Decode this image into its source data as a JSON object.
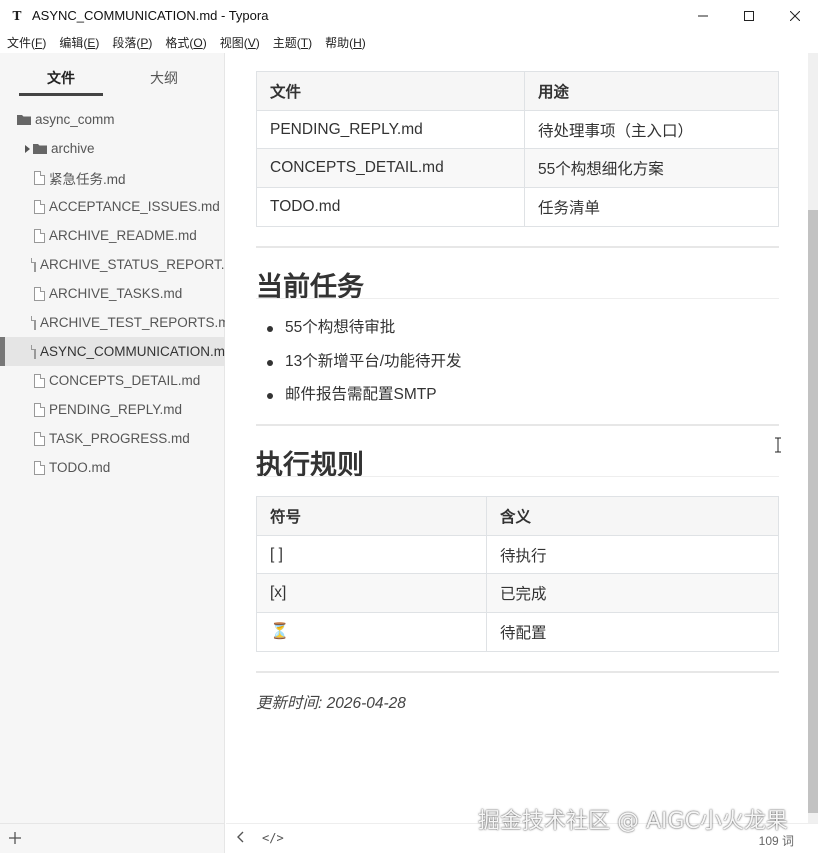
{
  "window": {
    "title": "ASYNC_COMMUNICATION.md - Typora",
    "app_icon_letter": "T"
  },
  "menu": [
    {
      "label": "文件(",
      "key": "F",
      "end": ")"
    },
    {
      "label": "编辑(",
      "key": "E",
      "end": ")"
    },
    {
      "label": "段落(",
      "key": "P",
      "end": ")"
    },
    {
      "label": "格式(",
      "key": "O",
      "end": ")"
    },
    {
      "label": "视图(",
      "key": "V",
      "end": ")"
    },
    {
      "label": "主题(",
      "key": "T",
      "end": ")"
    },
    {
      "label": "帮助(",
      "key": "H",
      "end": ")"
    }
  ],
  "sidebar": {
    "tab_files": "文件",
    "tab_outline": "大纲",
    "root_folder": "async_comm",
    "subfolder": "archive",
    "files": [
      "紧急任务.md",
      "ACCEPTANCE_ISSUES.md",
      "ARCHIVE_README.md",
      "ARCHIVE_STATUS_REPORT.md",
      "ARCHIVE_TASKS.md",
      "ARCHIVE_TEST_REPORTS.md",
      "ASYNC_COMMUNICATION.md",
      "CONCEPTS_DETAIL.md",
      "PENDING_REPLY.md",
      "TASK_PROGRESS.md",
      "TODO.md"
    ],
    "active_file": "ASYNC_COMMUNICATION.md"
  },
  "doc": {
    "table1": {
      "headers": [
        "文件",
        "用途"
      ],
      "rows": [
        [
          "PENDING_REPLY.md",
          "待处理事项（主入口）"
        ],
        [
          "CONCEPTS_DETAIL.md",
          "55个构想细化方案"
        ],
        [
          "TODO.md",
          "任务清单"
        ]
      ]
    },
    "h_current": "当前任务",
    "tasks": [
      "55个构想待审批",
      "13个新增平台/功能待开发",
      "邮件报告需配置SMTP"
    ],
    "h_rules": "执行规则",
    "table2": {
      "headers": [
        "符号",
        "含义"
      ],
      "rows": [
        [
          "[ ]",
          "待执行"
        ],
        [
          "[x]",
          "已完成"
        ],
        [
          "⏳",
          "待配置"
        ]
      ]
    },
    "updated": "更新时间: 2026-04-28"
  },
  "status": {
    "word_count": "109 词",
    "source_toggle": "</>"
  },
  "watermark": "掘金技术社区 @ AIGC小火龙果"
}
